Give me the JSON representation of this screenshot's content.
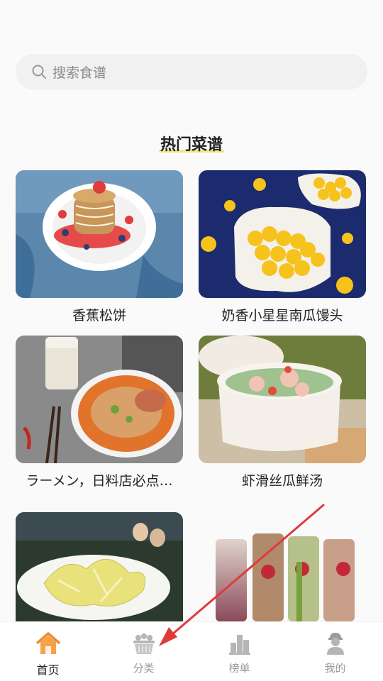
{
  "search": {
    "placeholder": "搜索食谱"
  },
  "section": {
    "title": "热门菜谱"
  },
  "recipes": [
    {
      "name": "香蕉松饼"
    },
    {
      "name": "奶香小星星南瓜馒头"
    },
    {
      "name": "ラーメン，日料店必点…"
    },
    {
      "name": "虾滑丝瓜鲜汤"
    },
    {
      "name": ""
    },
    {
      "name": ""
    }
  ],
  "tabs": [
    {
      "label": "首页",
      "icon": "home-icon",
      "active": true
    },
    {
      "label": "分类",
      "icon": "basket-icon",
      "active": false
    },
    {
      "label": "榜单",
      "icon": "bar-chart-icon",
      "active": false
    },
    {
      "label": "我的",
      "icon": "user-icon",
      "active": false
    }
  ],
  "colors": {
    "accent": "#f08a2c",
    "highlight": "#f5e27a",
    "arrow": "#e03b3b"
  }
}
